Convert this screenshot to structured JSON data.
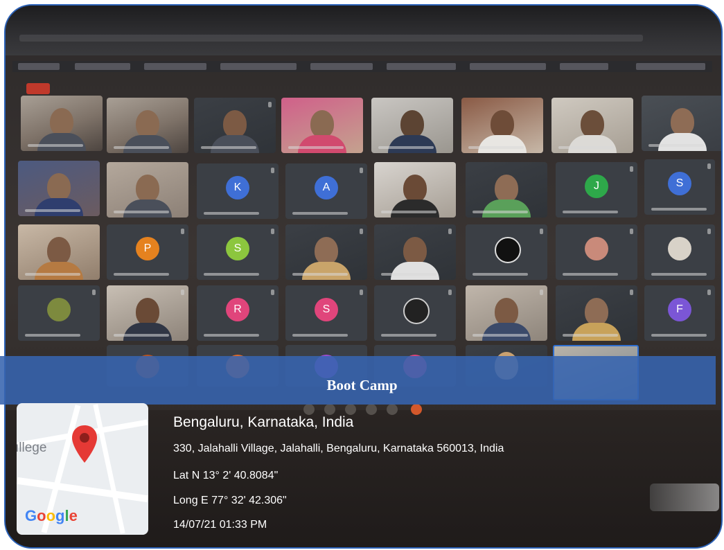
{
  "banner": {
    "title": "Boot Camp"
  },
  "location": {
    "city": "Bengaluru, Karnataka, India",
    "address": "330, Jalahalli Village, Jalahalli, Bengaluru, Karnataka 560013, India",
    "lat": "Lat N 13° 2' 40.8084\"",
    "long": "Long E 77° 32' 42.306\"",
    "datetime": "14/07/21 01:33 PM"
  },
  "map": {
    "place_label": "ıllege",
    "provider": "Google"
  },
  "participants": {
    "avatars": [
      {
        "letter": "K",
        "color": "#3f6fd6"
      },
      {
        "letter": "A",
        "color": "#3f6fd6"
      },
      {
        "letter": "J",
        "color": "#2ea84a"
      },
      {
        "letter": "S",
        "color": "#3f6fd6"
      },
      {
        "letter": "P",
        "color": "#e5821f"
      },
      {
        "letter": "S",
        "color": "#8cc63e"
      },
      {
        "letter": "R",
        "color": "#e0457b"
      },
      {
        "letter": "S",
        "color": "#e0457b"
      },
      {
        "letter": "F",
        "color": "#7b56d6"
      }
    ]
  },
  "colors": {
    "banner": "#3764af",
    "border": "#2b62b8",
    "record": "#c0392b"
  }
}
